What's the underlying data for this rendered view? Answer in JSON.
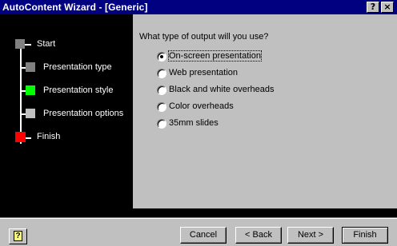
{
  "window": {
    "title": "AutoContent Wizard - [Generic]",
    "help_glyph": "?",
    "close_glyph": "×"
  },
  "steps": [
    {
      "label": "Start",
      "color": "#808080"
    },
    {
      "label": "Presentation type",
      "color": "#808080"
    },
    {
      "label": "Presentation style",
      "color": "#00ff00"
    },
    {
      "label": "Presentation options",
      "color": "#c0c0c0"
    },
    {
      "label": "Finish",
      "color": "#ff0000"
    }
  ],
  "page": {
    "question": "What type of output will you use?",
    "options": [
      {
        "label": "On-screen presentation",
        "selected": true
      },
      {
        "label": "Web presentation",
        "selected": false
      },
      {
        "label": "Black and white overheads",
        "selected": false
      },
      {
        "label": "Color overheads",
        "selected": false
      },
      {
        "label": "35mm slides",
        "selected": false
      }
    ]
  },
  "footer": {
    "help_glyph": "?",
    "cancel_label": "Cancel",
    "back_label": "< Back",
    "next_label": "Next >",
    "finish_label": "Finish"
  }
}
